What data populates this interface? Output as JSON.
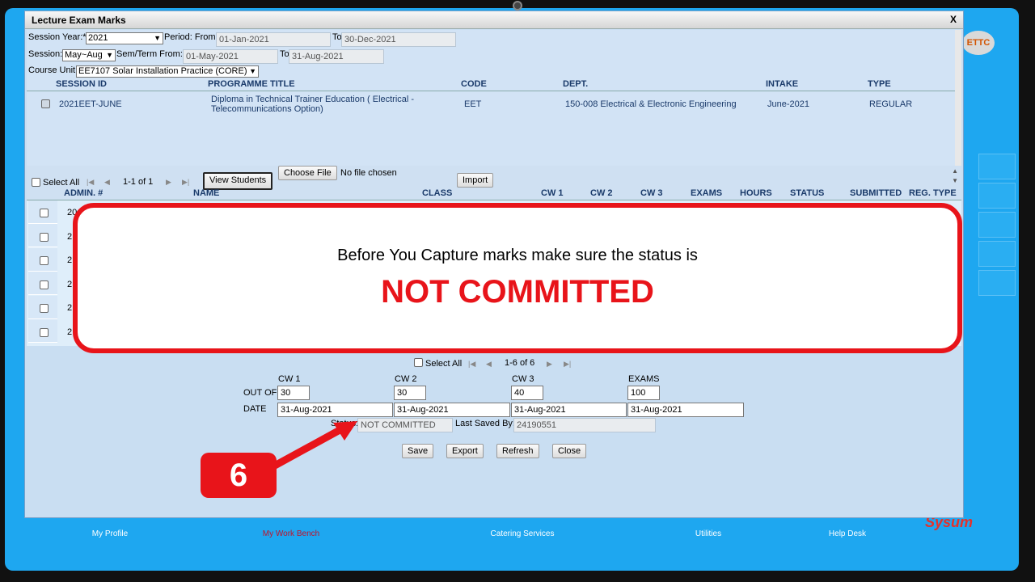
{
  "dialog": {
    "title": "Lecture Exam Marks",
    "close_label": "X"
  },
  "filters": {
    "session_year_label": "Session Year:*",
    "session_year_value": "2021",
    "period_from_label": "Period: From",
    "period_from_value": "01-Jan-2021",
    "period_to_label": "To",
    "period_to_value": "30-Dec-2021",
    "session_label": "Session:",
    "session_value": "May~Aug",
    "sem_from_label": "Sem/Term From:",
    "sem_from_value": "01-May-2021",
    "sem_to_label": "To",
    "sem_to_value": "31-Aug-2021",
    "course_unit_label": "Course Unit",
    "course_unit_value": "EE7107 Solar Installation Practice (CORE)"
  },
  "programme_table": {
    "headers": [
      "SESSION ID",
      "PROGRAMME TITLE",
      "CODE",
      "DEPT.",
      "INTAKE",
      "TYPE"
    ],
    "row": {
      "session_id": "2021EET-JUNE",
      "title_line1": "Diploma in Technical Trainer Education ( Electrical -",
      "title_line2": "Telecommunications Option)",
      "code": "EET",
      "dept": "150-008 Electrical & Electronic Engineering",
      "intake": "June-2021",
      "type": "REGULAR"
    }
  },
  "student_toolbar": {
    "select_all": "Select All",
    "pager": "1-1 of 1",
    "view_students": "View Students",
    "choose_file": "Choose File",
    "no_file": "No file chosen",
    "import": "Import"
  },
  "student_table": {
    "headers": [
      "ADMIN. #",
      "NAME",
      "CLASS",
      "CW 1",
      "CW 2",
      "CW 3",
      "EXAMS",
      "HOURS",
      "STATUS",
      "SUBMITTED",
      "REG. TYPE"
    ],
    "row_prefixes": [
      "20",
      "2",
      "2",
      "2",
      "2",
      "2"
    ]
  },
  "overlay": {
    "line1": "Before You Capture marks make sure the status is",
    "line2": "NOT COMMITTED"
  },
  "bottom_panel": {
    "select_all": "Select All",
    "pager": "1-6 of 6",
    "out_of_label": "OUT OF",
    "date_label": "DATE",
    "columns": [
      {
        "name": "CW 1",
        "out_of": "30",
        "date": "31-Aug-2021"
      },
      {
        "name": "CW 2",
        "out_of": "30",
        "date": "31-Aug-2021"
      },
      {
        "name": "CW 3",
        "out_of": "40",
        "date": "31-Aug-2021"
      },
      {
        "name": "EXAMS",
        "out_of": "100",
        "date": "31-Aug-2021"
      }
    ],
    "status_label": "Status:",
    "status_value": "NOT COMMITTED",
    "last_saved_label": "Last Saved By:",
    "last_saved_value": "24190551",
    "buttons": [
      "Save",
      "Export",
      "Refresh",
      "Close"
    ]
  },
  "callout": {
    "step": "6"
  },
  "background": {
    "logo_text": "ETTC",
    "bottom_nav": [
      "My Profile",
      "My Work Bench",
      "Catering Services",
      "Utilities",
      "Help Desk"
    ],
    "brand": "Sysum",
    "accent_color": "#1ea7f0",
    "highlight_color": "#e8141a"
  }
}
